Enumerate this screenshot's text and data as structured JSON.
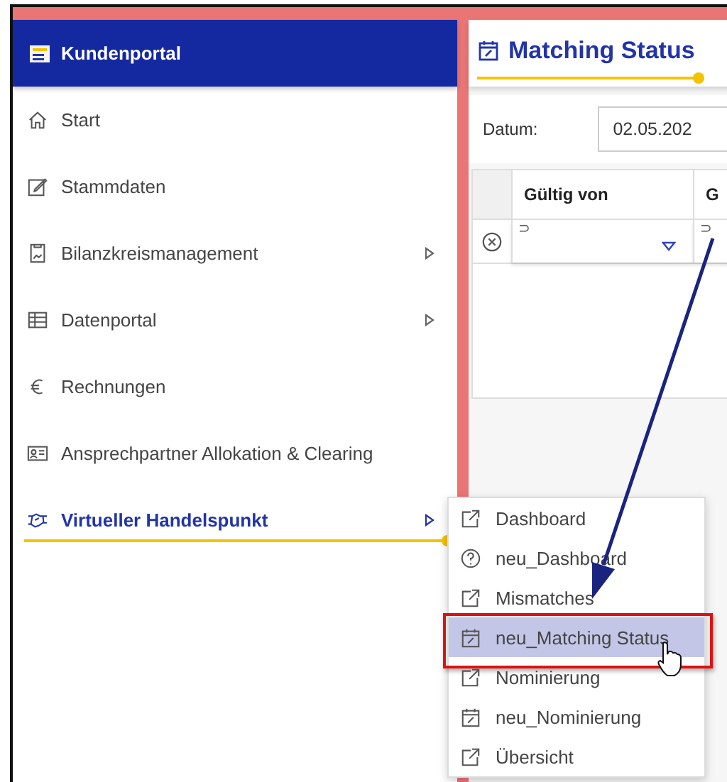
{
  "sidebar": {
    "title": "Kundenportal",
    "items": [
      {
        "label": "Start",
        "has_submenu": false,
        "selected": false
      },
      {
        "label": "Stammdaten",
        "has_submenu": false,
        "selected": false
      },
      {
        "label": "Bilanzkreismanagement",
        "has_submenu": true,
        "selected": false
      },
      {
        "label": "Datenportal",
        "has_submenu": true,
        "selected": false
      },
      {
        "label": "Rechnungen",
        "has_submenu": false,
        "selected": false
      },
      {
        "label": "Ansprechpartner Allokation & Clearing",
        "has_submenu": false,
        "selected": false
      },
      {
        "label": "Virtueller Handelspunkt",
        "has_submenu": true,
        "selected": true
      }
    ]
  },
  "page": {
    "title": "Matching Status",
    "date_label": "Datum:",
    "date_value": "02.05.202",
    "table": {
      "columns": [
        "Gültig von",
        "G"
      ],
      "filter_symbols": [
        "⊃",
        "⊃"
      ]
    }
  },
  "submenu": {
    "items": [
      {
        "label": "Dashboard",
        "selected": false
      },
      {
        "label": "neu_Dashboard",
        "selected": false
      },
      {
        "label": "Mismatches",
        "selected": false
      },
      {
        "label": "neu_Matching Status",
        "selected": true
      },
      {
        "label": "Nominierung",
        "selected": false
      },
      {
        "label": "neu_Nominierung",
        "selected": false
      },
      {
        "label": "Übersicht",
        "selected": false
      }
    ]
  }
}
